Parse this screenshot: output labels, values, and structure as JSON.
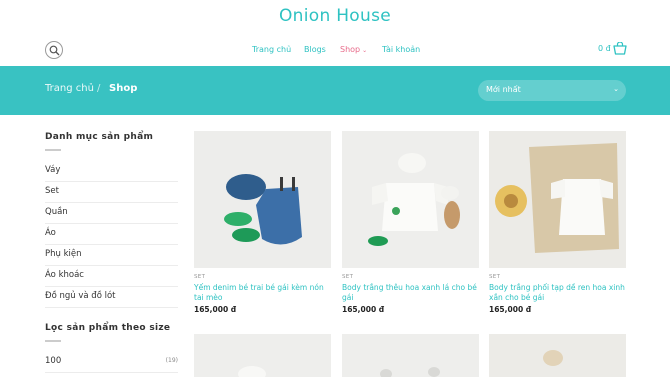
{
  "site": {
    "brand": "Onion House"
  },
  "nav": {
    "items": [
      {
        "label": "Trang chủ"
      },
      {
        "label": "Blogs"
      },
      {
        "label": "Shop"
      },
      {
        "label": "Tài khoản"
      }
    ],
    "cart_total": "0 đ"
  },
  "hero": {
    "breadcrumb": {
      "home": "Trang chủ",
      "separator": "/",
      "current": "Shop"
    },
    "sort_value": "Mới nhất"
  },
  "sidebar": {
    "category_title": "Danh mục sản phẩm",
    "categories": [
      "Váy",
      "Set",
      "Quần",
      "Áo",
      "Phụ kiện",
      "Áo khoác",
      "Đồ ngủ và đồ lót"
    ],
    "size_title": "Lọc sản phẩm theo size",
    "sizes": [
      {
        "label": "100",
        "count": "(19)"
      }
    ]
  },
  "products": [
    {
      "category": "SET",
      "title": "Yếm denim bé trai bé gái kèm nón tai mèo",
      "price": "165,000 đ"
    },
    {
      "category": "SET",
      "title": "Body trắng thêu hoa xanh lá cho bé gái",
      "price": "165,000 đ"
    },
    {
      "category": "SET",
      "title": "Body trắng phối tạp dề ren hoa xinh xắn cho bé gái",
      "price": "165,000 đ"
    }
  ],
  "colors": {
    "accent": "#2ec2c2",
    "hero_bg": "#39c2c2",
    "active_nav": "#e86b8a"
  },
  "icons": {
    "search": "search-icon",
    "cart": "cart-icon",
    "caret": "chevron-down-icon"
  }
}
